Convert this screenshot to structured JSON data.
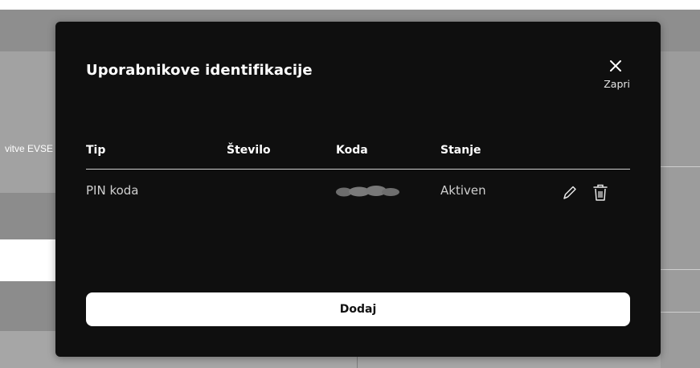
{
  "background": {
    "partial_text": "vitve EVSE"
  },
  "modal": {
    "title": "Uporabnikove identifikacije",
    "close": {
      "icon": "close-icon",
      "label": "Zapri"
    },
    "table": {
      "columns": [
        "Tip",
        "Število",
        "Koda",
        "Stanje"
      ],
      "rows": [
        {
          "tip": "PIN koda",
          "stevilo": "",
          "koda": "",
          "koda_note": "obscured",
          "stanje": "Aktiven",
          "actions": [
            "pencil-icon",
            "trash-icon"
          ]
        }
      ]
    },
    "add_button_label": "Dodaj"
  },
  "colors": {
    "modal_background": "#0f0f0f",
    "text_primary": "#ffffff",
    "text_secondary": "#cfcfcf",
    "button_background": "#ffffff",
    "overlay_gray": "#8e8e8e"
  }
}
